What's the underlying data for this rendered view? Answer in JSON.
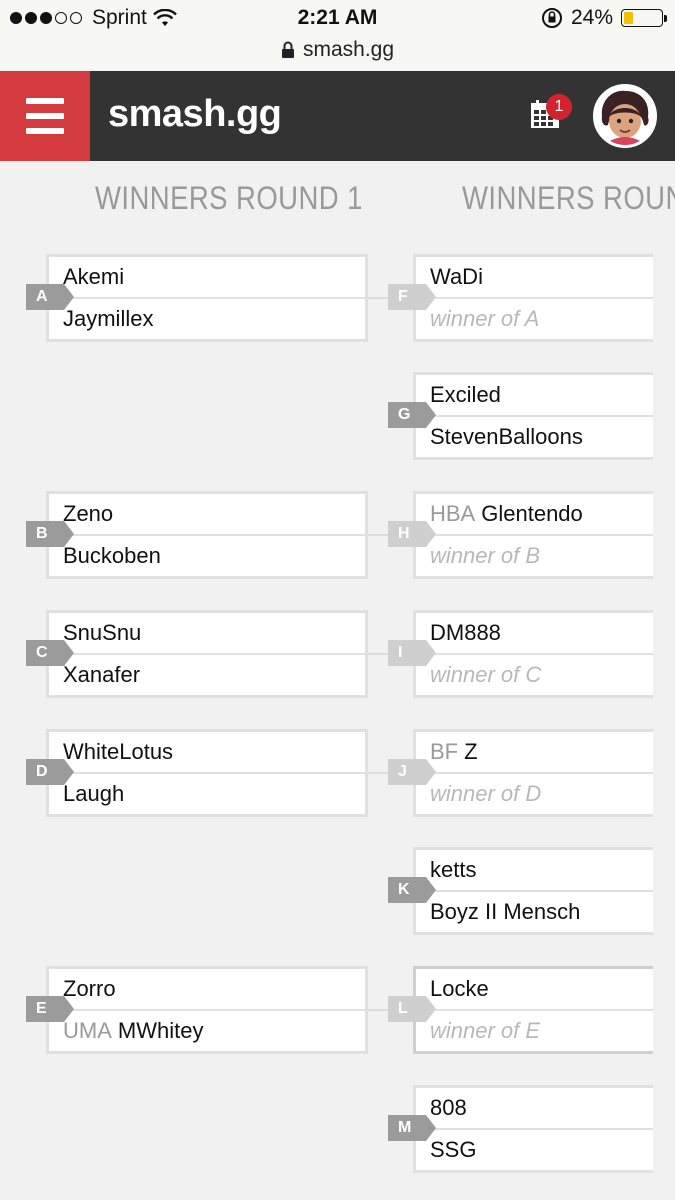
{
  "status": {
    "carrier": "Sprint",
    "time": "2:21 AM",
    "battery": "24%",
    "battery_level": 0.24
  },
  "browser": {
    "url": "smash.gg"
  },
  "nav": {
    "logo": "smash.gg",
    "notification_count": "1"
  },
  "rounds": [
    {
      "title": "WINNERS ROUND 1"
    },
    {
      "title": "WINNERS ROUN"
    }
  ],
  "round1": [
    {
      "id": "A",
      "top": {
        "prefix": "",
        "name": "Akemi"
      },
      "bottom": {
        "prefix": "",
        "name": "Jaymillex"
      }
    },
    {
      "id": "B",
      "top": {
        "prefix": "",
        "name": "Zeno"
      },
      "bottom": {
        "prefix": "",
        "name": "Buckoben"
      }
    },
    {
      "id": "C",
      "top": {
        "prefix": "",
        "name": "SnuSnu"
      },
      "bottom": {
        "prefix": "",
        "name": "Xanafer"
      }
    },
    {
      "id": "D",
      "top": {
        "prefix": "",
        "name": "WhiteLotus"
      },
      "bottom": {
        "prefix": "",
        "name": "Laugh"
      }
    },
    {
      "id": "E",
      "top": {
        "prefix": "",
        "name": "Zorro"
      },
      "bottom": {
        "prefix": "UMA",
        "name": "MWhitey"
      }
    }
  ],
  "round2": [
    {
      "id": "F",
      "top": {
        "prefix": "",
        "name": "WaDi"
      },
      "bottom": {
        "placeholder": "winner of A"
      }
    },
    {
      "id": "G",
      "top": {
        "prefix": "",
        "name": "Exciled"
      },
      "bottom": {
        "prefix": "",
        "name": "StevenBalloons"
      }
    },
    {
      "id": "H",
      "top": {
        "prefix": "HBA",
        "name": "Glentendo"
      },
      "bottom": {
        "placeholder": "winner of B"
      }
    },
    {
      "id": "I",
      "top": {
        "prefix": "",
        "name": "DM888"
      },
      "bottom": {
        "placeholder": "winner of C"
      }
    },
    {
      "id": "J",
      "top": {
        "prefix": "BF",
        "name": "Z"
      },
      "bottom": {
        "placeholder": "winner of D"
      }
    },
    {
      "id": "K",
      "top": {
        "prefix": "",
        "name": "ketts"
      },
      "bottom": {
        "prefix": "",
        "name": "Boyz II Mensch"
      }
    },
    {
      "id": "L",
      "top": {
        "prefix": "",
        "name": "Locke"
      },
      "bottom": {
        "placeholder": "winner of E"
      }
    },
    {
      "id": "M",
      "top": {
        "prefix": "",
        "name": "808"
      },
      "bottom": {
        "prefix": "",
        "name": "SSG"
      }
    }
  ],
  "colors": {
    "brand_red": "#d33b3f",
    "nav_bg": "#333333",
    "tag_dark": "#9b9b9b",
    "tag_light": "#cfcfcf"
  },
  "icons": [
    "signal-dots-icon",
    "wifi-icon",
    "orientation-lock-icon",
    "battery-icon",
    "lock-icon",
    "hamburger-menu-icon",
    "calendar-icon"
  ]
}
